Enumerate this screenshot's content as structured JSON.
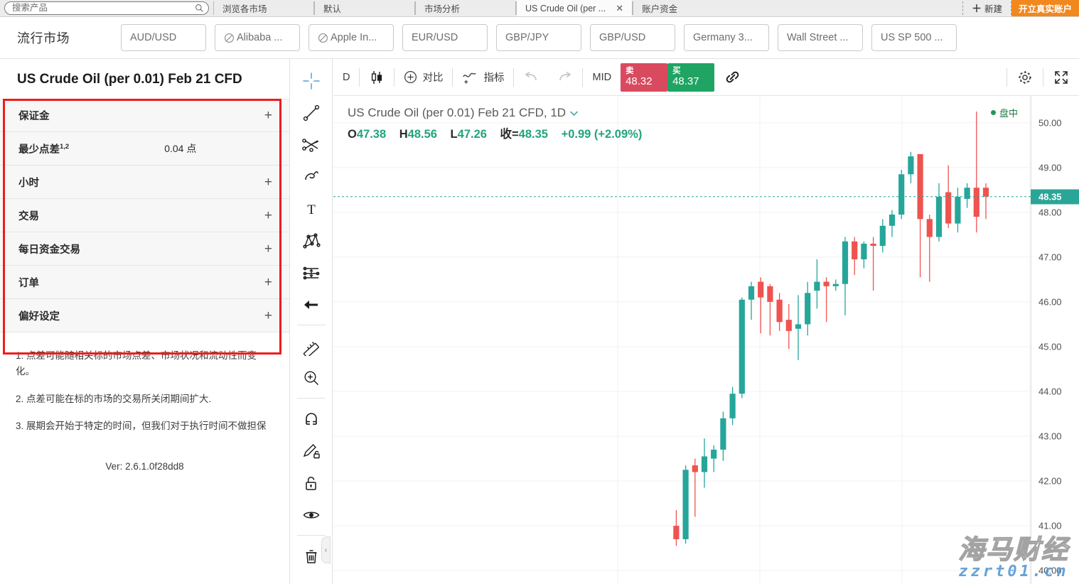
{
  "topbar": {
    "search_placeholder": "搜索产品",
    "tabs": [
      {
        "label": "浏览各市场",
        "active": false,
        "closable": false
      },
      {
        "label": "默认",
        "active": false,
        "closable": false
      },
      {
        "label": "市场分析",
        "active": false,
        "closable": false
      },
      {
        "label": "US Crude Oil (per ...",
        "active": true,
        "closable": true
      },
      {
        "label": "账户资金",
        "active": false,
        "closable": false
      }
    ],
    "new_tab_label": "新建",
    "open_account_label": "开立真实账户",
    "close_icon": "✕"
  },
  "watchlist": {
    "title": "流行市场",
    "chips": [
      {
        "label": "AUD/USD",
        "closed": false
      },
      {
        "label": "Alibaba ...",
        "closed": true
      },
      {
        "label": "Apple In...",
        "closed": true
      },
      {
        "label": "EUR/USD",
        "closed": false
      },
      {
        "label": "GBP/JPY",
        "closed": false
      },
      {
        "label": "GBP/USD",
        "closed": false
      },
      {
        "label": "Germany 3...",
        "closed": false
      },
      {
        "label": "Wall Street ...",
        "closed": false
      },
      {
        "label": "US SP 500 ...",
        "closed": false
      }
    ]
  },
  "leftpanel": {
    "instrument_title": "US Crude Oil (per 0.01) Feb 21 CFD",
    "rows": [
      {
        "label": "保证金",
        "sup": "",
        "value": "",
        "expand": "+"
      },
      {
        "label": "最少点差",
        "sup": "1,2",
        "value": "0.04 点",
        "expand": ""
      },
      {
        "label": "小时",
        "sup": "",
        "value": "",
        "expand": "+"
      },
      {
        "label": "交易",
        "sup": "",
        "value": "",
        "expand": "+"
      },
      {
        "label": "每日资金交易",
        "sup": "",
        "value": "",
        "expand": "+"
      },
      {
        "label": "订单",
        "sup": "",
        "value": "",
        "expand": "+"
      },
      {
        "label": "偏好设定",
        "sup": "",
        "value": "",
        "expand": "+"
      }
    ],
    "footnotes": [
      "1. 点差可能随相关标的市场点差、市场状况和流动性而变化。",
      "2. 点差可能在标的市场的交易所关闭期间扩大.",
      "3. 展期会开始于特定的时间，但我们对于执行时间不做担保"
    ],
    "version": "Ver: 2.6.1.0f28dd8"
  },
  "drawtools": [
    {
      "name": "crosshair-tool",
      "active": true
    },
    {
      "name": "trend-line-tool",
      "active": false
    },
    {
      "name": "fib-fork-tool",
      "active": false
    },
    {
      "name": "brush-tool",
      "active": false
    },
    {
      "name": "text-tool",
      "active": false
    },
    {
      "name": "pattern-tool",
      "active": false
    },
    {
      "name": "forecast-tool",
      "active": false
    },
    {
      "name": "arrow-tool",
      "active": false
    },
    {
      "name": "measure-tool",
      "active": false
    },
    {
      "name": "zoom-in-tool",
      "active": false
    },
    {
      "name": "magnet-tool",
      "active": false
    },
    {
      "name": "stay-drawing-tool",
      "active": false
    },
    {
      "name": "lock-drawings-tool",
      "active": false
    },
    {
      "name": "hide-drawings-tool",
      "active": false
    },
    {
      "name": "remove-drawings-tool",
      "active": false
    }
  ],
  "charttoolbar": {
    "interval": "D",
    "compare_label": "对比",
    "indicators_label": "指标",
    "mid_label": "MID",
    "sell": {
      "label": "卖",
      "price": "48.32",
      "color": "#d94a5f"
    },
    "buy": {
      "label": "买",
      "price": "48.37",
      "color": "#1fa463"
    }
  },
  "chart_data": {
    "type": "candlestick",
    "title": "US Crude Oil (per 0.01) Feb 21 CFD, 1D",
    "symbol": "US Crude Oil (per 0.01) Feb 21 CFD",
    "interval": "1D",
    "session_label": "盘中",
    "ohlc": {
      "open_label": "O",
      "open": "47.38",
      "high_label": "H",
      "high": "48.56",
      "low_label": "L",
      "low": "47.26",
      "close_label": "收=",
      "close": "48.35",
      "change": "+0.99",
      "change_pct": "(+2.09%)"
    },
    "current_price": "48.35",
    "ylim": [
      39.7,
      50.6
    ],
    "yticks": [
      "50.00",
      "49.00",
      "48.00",
      "47.00",
      "46.00",
      "45.00",
      "44.00",
      "43.00",
      "42.00",
      "41.00",
      "40.00"
    ],
    "grid": true,
    "up_color": "#26a69a",
    "down_color": "#ef5350",
    "candles": [
      {
        "o": 41.0,
        "h": 41.35,
        "l": 40.55,
        "c": 40.7
      },
      {
        "o": 40.7,
        "h": 42.35,
        "l": 40.6,
        "c": 42.25
      },
      {
        "o": 42.35,
        "h": 42.5,
        "l": 41.2,
        "c": 42.2
      },
      {
        "o": 42.2,
        "h": 42.95,
        "l": 41.85,
        "c": 42.55
      },
      {
        "o": 42.5,
        "h": 42.8,
        "l": 42.2,
        "c": 42.7
      },
      {
        "o": 42.7,
        "h": 43.55,
        "l": 42.45,
        "c": 43.4
      },
      {
        "o": 43.4,
        "h": 44.1,
        "l": 43.25,
        "c": 43.95
      },
      {
        "o": 43.95,
        "h": 46.1,
        "l": 43.85,
        "c": 46.05
      },
      {
        "o": 46.05,
        "h": 46.45,
        "l": 45.6,
        "c": 46.35
      },
      {
        "o": 46.45,
        "h": 46.55,
        "l": 45.3,
        "c": 46.1
      },
      {
        "o": 46.35,
        "h": 46.4,
        "l": 45.25,
        "c": 46.0
      },
      {
        "o": 46.05,
        "h": 46.2,
        "l": 45.35,
        "c": 45.55
      },
      {
        "o": 45.6,
        "h": 45.95,
        "l": 44.95,
        "c": 45.35
      },
      {
        "o": 45.4,
        "h": 46.15,
        "l": 44.7,
        "c": 45.5
      },
      {
        "o": 45.5,
        "h": 46.45,
        "l": 45.25,
        "c": 46.2
      },
      {
        "o": 46.25,
        "h": 46.95,
        "l": 45.85,
        "c": 46.45
      },
      {
        "o": 46.45,
        "h": 46.55,
        "l": 45.55,
        "c": 46.35
      },
      {
        "o": 46.35,
        "h": 46.5,
        "l": 46.25,
        "c": 46.4
      },
      {
        "o": 46.4,
        "h": 47.45,
        "l": 45.7,
        "c": 47.35
      },
      {
        "o": 47.35,
        "h": 47.45,
        "l": 46.6,
        "c": 46.95
      },
      {
        "o": 46.95,
        "h": 47.35,
        "l": 46.75,
        "c": 47.3
      },
      {
        "o": 47.3,
        "h": 47.45,
        "l": 46.25,
        "c": 47.25
      },
      {
        "o": 47.25,
        "h": 47.85,
        "l": 47.1,
        "c": 47.7
      },
      {
        "o": 47.7,
        "h": 48.05,
        "l": 47.45,
        "c": 47.95
      },
      {
        "o": 47.95,
        "h": 48.95,
        "l": 47.85,
        "c": 48.85
      },
      {
        "o": 48.85,
        "h": 49.35,
        "l": 48.65,
        "c": 49.25
      },
      {
        "o": 49.3,
        "h": 49.3,
        "l": 46.55,
        "c": 47.85
      },
      {
        "o": 47.85,
        "h": 47.95,
        "l": 46.45,
        "c": 47.45
      },
      {
        "o": 47.45,
        "h": 48.65,
        "l": 47.35,
        "c": 48.35
      },
      {
        "o": 48.45,
        "h": 49.05,
        "l": 47.65,
        "c": 47.75
      },
      {
        "o": 47.75,
        "h": 48.55,
        "l": 47.55,
        "c": 48.35
      },
      {
        "o": 48.3,
        "h": 48.65,
        "l": 48.1,
        "c": 48.55
      },
      {
        "o": 48.55,
        "h": 50.25,
        "l": 47.55,
        "c": 47.9
      },
      {
        "o": 48.55,
        "h": 48.65,
        "l": 47.85,
        "c": 48.35
      }
    ]
  },
  "watermark": {
    "line1": "海马财经",
    "line2": "zzrt01.cn"
  }
}
